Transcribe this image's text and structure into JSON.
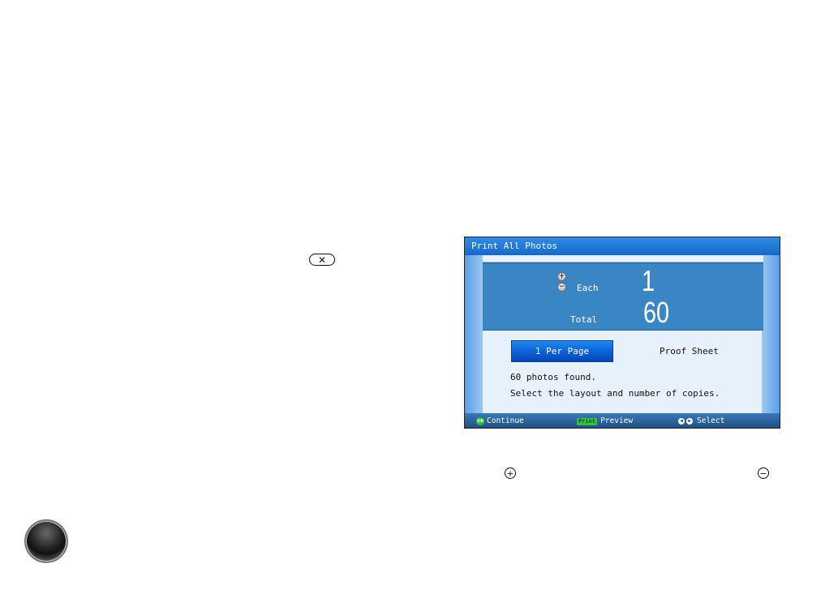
{
  "manual": {
    "cancel_glyph": "✕",
    "plus_glyph": "+",
    "minus_glyph": "−"
  },
  "screen": {
    "title": "Print All Photos",
    "copies": {
      "plus_glyph": "+",
      "minus_glyph": "−",
      "each_label": "Each",
      "each_value": "1",
      "total_label": "Total",
      "total_value": "60"
    },
    "layout_options": {
      "selected": "1 Per Page",
      "other": "Proof Sheet"
    },
    "messages": {
      "line1": "60 photos found.",
      "line2": "Select the layout and number of copies."
    },
    "status": {
      "ok_badge": "OK",
      "continue_label": "Continue",
      "print_badge": "Print",
      "preview_label": "Preview",
      "nav_left": "◀",
      "nav_right": "▶",
      "select_label": "Select"
    },
    "colors": {
      "titlebar": "#1f7ad8",
      "panel": "#3a86c4",
      "selected_option": "#0a5fd6",
      "status_green": "#33c23f"
    }
  }
}
